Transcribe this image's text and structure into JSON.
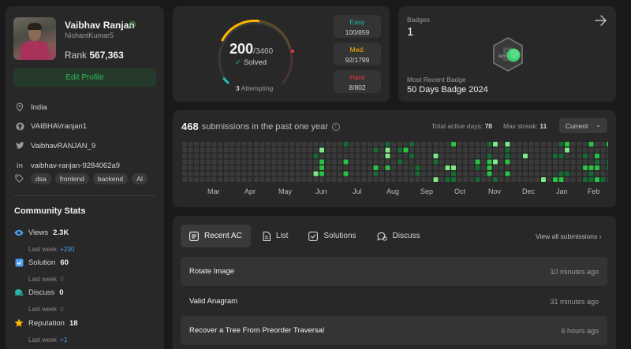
{
  "profile": {
    "name": "Vaibhav Ranjan",
    "username": "NishantKumar5",
    "rank_label": "Rank",
    "rank_value": "567,363",
    "edit_label": "Edit Profile",
    "location": "India",
    "github": "VAIBHAVranjan1",
    "twitter": "VaibhavRANJAN_9",
    "linkedin": "vaibhav-ranjan-9284062a9",
    "tags": [
      "dsa",
      "frontend",
      "backend",
      "AI"
    ]
  },
  "community": {
    "title": "Community Stats",
    "stats": [
      {
        "label": "Views",
        "value": "2.3K",
        "sub_label": "Last week",
        "sub_value": "+230",
        "icon": "eye-icon",
        "color": "#4f9df5"
      },
      {
        "label": "Solution",
        "value": "60",
        "sub_label": "Last week",
        "sub_value": "0",
        "icon": "checkbox-icon",
        "color": "#4f9df5"
      },
      {
        "label": "Discuss",
        "value": "0",
        "sub_label": "Last week",
        "sub_value": "0",
        "icon": "chat-icon",
        "color": "#28b4a6"
      },
      {
        "label": "Reputation",
        "value": "18",
        "sub_label": "Last week",
        "sub_value": "+1",
        "icon": "star-icon",
        "color": "#ffb800"
      }
    ]
  },
  "progress": {
    "solved": "200",
    "total": "/3460",
    "solved_label": "Solved",
    "attempting_count": "3",
    "attempting_label": "Attempting",
    "difficulties": [
      {
        "label": "Easy",
        "value": "100/859",
        "color": "#1cbaba"
      },
      {
        "label": "Med.",
        "value": "92/1799",
        "color": "#ffb700"
      },
      {
        "label": "Hard",
        "value": "8/802",
        "color": "#f63737"
      }
    ]
  },
  "badges": {
    "label": "Badges",
    "count": "1",
    "recent_label": "Most Recent Badge",
    "recent_name": "50 Days Badge 2024",
    "icon_text": "DAYS"
  },
  "submissions": {
    "count": "468",
    "text": "submissions in the past one year",
    "active_label": "Total active days:",
    "active_value": "78",
    "streak_label": "Max streak:",
    "streak_value": "11",
    "selector": "Current",
    "months": [
      "Mar",
      "Apr",
      "May",
      "Jun",
      "Jul",
      "Aug",
      "Sep",
      "Oct",
      "Nov",
      "Dec",
      "Jan",
      "Feb"
    ]
  },
  "recent": {
    "tabs": [
      {
        "label": "Recent AC",
        "icon": "list-check-icon"
      },
      {
        "label": "List",
        "icon": "document-icon"
      },
      {
        "label": "Solutions",
        "icon": "checkbox-icon"
      },
      {
        "label": "Discuss",
        "icon": "chat-icon"
      }
    ],
    "view_all": "View all submissions",
    "items": [
      {
        "title": "Rotate Image",
        "ago": "10 minutes ago"
      },
      {
        "title": "Valid Anagram",
        "ago": "31 minutes ago"
      },
      {
        "title": "Recover a Tree From Preorder Traversal",
        "ago": "6 hours ago"
      }
    ]
  }
}
